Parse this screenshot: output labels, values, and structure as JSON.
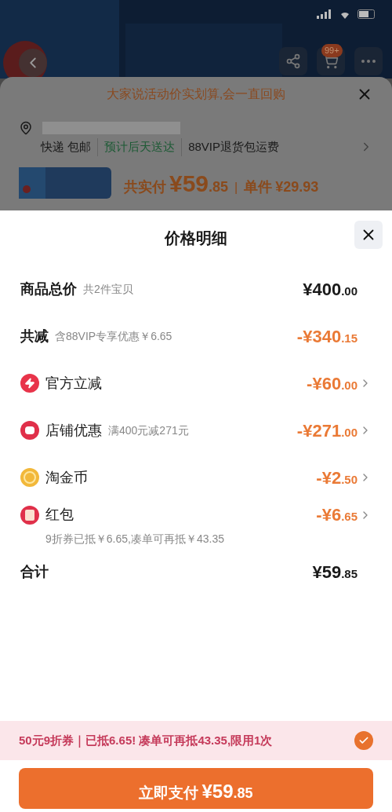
{
  "top_bar": {
    "cart_badge": "99+"
  },
  "background_sheet": {
    "banner": "大家说活动价实划算,会一直回购",
    "delivery": [
      {
        "text": "快递 包邮",
        "kind": "plain"
      },
      {
        "text": "预计后天送达",
        "kind": "highlight"
      },
      {
        "text": "88VIP退货包运费",
        "kind": "plain"
      }
    ],
    "total_label": "共实付",
    "total_price": "¥59.85",
    "separator": "|",
    "unit_label": "单件",
    "unit_price": "¥29.93"
  },
  "sheet": {
    "title": "价格明细",
    "rows": [
      {
        "kind": "plain",
        "label": "商品总价",
        "note": "共2件宝贝",
        "amount": "¥400.00",
        "discount": false,
        "has_arrow": false
      },
      {
        "kind": "plain",
        "label": "共减",
        "note": "含88VIP专享优惠￥6.65",
        "amount": "-¥340.15",
        "discount": true,
        "has_arrow": false
      },
      {
        "kind": "bolt",
        "label": "官方立减",
        "amount": "-¥60.00",
        "discount": true,
        "has_arrow": true
      },
      {
        "kind": "shop",
        "label": "店铺优惠",
        "note": "满400元减271元",
        "amount": "-¥271.00",
        "discount": true,
        "has_arrow": true
      },
      {
        "kind": "coin",
        "label": "淘金币",
        "amount": "-¥2.50",
        "discount": true,
        "has_arrow": true
      },
      {
        "kind": "packet",
        "label": "红包",
        "amount": "-¥6.65",
        "discount": true,
        "has_arrow": true,
        "detail": "9折券已抵￥6.65,凑单可再抵￥43.35"
      },
      {
        "kind": "plain",
        "label": "合计",
        "amount": "¥59.85",
        "discount": false,
        "has_arrow": false
      }
    ],
    "coupon": {
      "text": "50元9折券｜已抵6.65! 凑单可再抵43.35,限用1次",
      "checked": true
    },
    "pay_label": "立即支付",
    "pay_amount": "¥59.85"
  }
}
